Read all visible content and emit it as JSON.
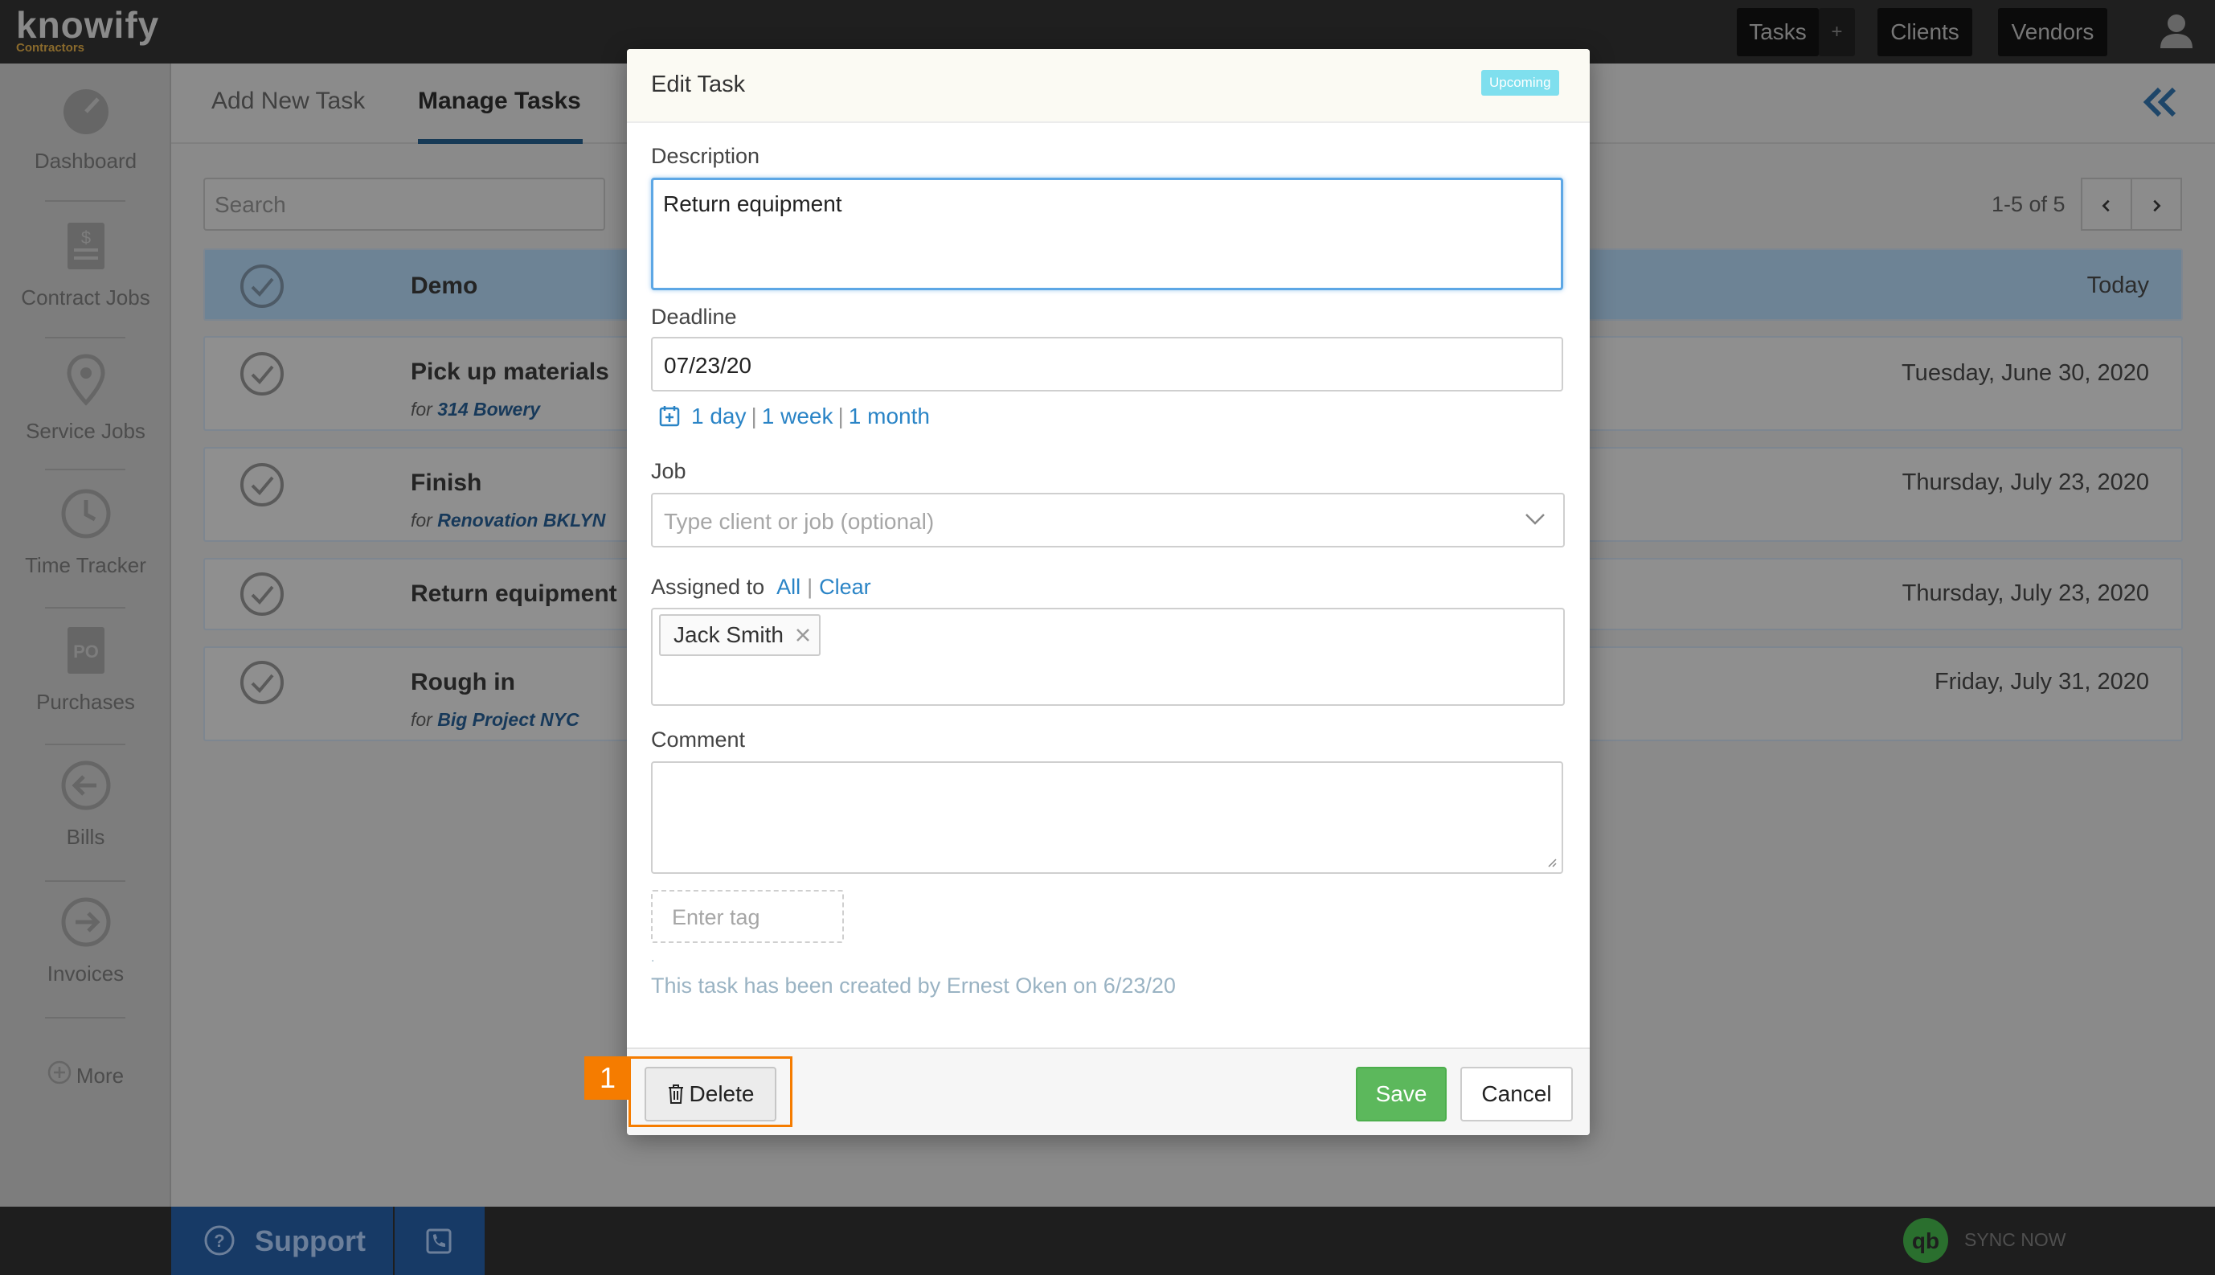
{
  "app": {
    "logo_text": "knowify",
    "logo_sub": "Contractors"
  },
  "topnav": {
    "tasks": "Tasks",
    "plus": "+",
    "clients": "Clients",
    "vendors": "Vendors"
  },
  "sidebar": {
    "items": [
      {
        "label": "Dashboard",
        "icon": "dashboard-gauge-icon"
      },
      {
        "label": "Contract Jobs",
        "icon": "contract-document-icon"
      },
      {
        "label": "Service Jobs",
        "icon": "map-pin-icon"
      },
      {
        "label": "Time Tracker",
        "icon": "clock-icon"
      },
      {
        "label": "Purchases",
        "icon": "purchase-order-icon"
      },
      {
        "label": "Bills",
        "icon": "arrow-left-circle-icon"
      },
      {
        "label": "Invoices",
        "icon": "arrow-right-circle-icon"
      }
    ],
    "more": "More"
  },
  "tabs": {
    "add_new": "Add New Task",
    "manage": "Manage Tasks"
  },
  "list": {
    "search_placeholder": "Search",
    "pager": "1-5 of 5",
    "tasks": [
      {
        "title": "Demo",
        "for_prefix": "",
        "job": "",
        "date": "Today"
      },
      {
        "title": "Pick up materials",
        "for_prefix": "for",
        "job": "314 Bowery",
        "date": "Tuesday, June 30, 2020"
      },
      {
        "title": "Finish",
        "for_prefix": "for",
        "job": "Renovation BKLYN",
        "date": "Thursday, July 23, 2020"
      },
      {
        "title": "Return equipment",
        "for_prefix": "",
        "job": "",
        "date": "Thursday, July 23, 2020"
      },
      {
        "title": "Rough in",
        "for_prefix": "for",
        "job": "Big Project NYC",
        "date": "Friday, July 31, 2020"
      }
    ]
  },
  "modal": {
    "title": "Edit Task",
    "status_badge": "Upcoming",
    "description_label": "Description",
    "description_value": "Return equipment",
    "deadline_label": "Deadline",
    "deadline_value": "07/23/20",
    "quick": {
      "day": "1 day",
      "week": "1 week",
      "month": "1 month",
      "sep": "|"
    },
    "job_label": "Job",
    "job_placeholder": "Type client or job (optional)",
    "assigned_label": "Assigned to",
    "assigned_all": "All",
    "assigned_sep": "|",
    "assigned_clear": "Clear",
    "assignee": "Jack Smith",
    "comment_label": "Comment",
    "comment_value": "",
    "tag_placeholder": "Enter tag",
    "dot": ".",
    "created_note": "This task has been created by Ernest Oken on 6/23/20",
    "delete_label": "Delete",
    "save_label": "Save",
    "cancel_label": "Cancel"
  },
  "annotation": {
    "marker": "1",
    "color": "#f57c00"
  },
  "footer": {
    "support": "Support",
    "sync": "SYNC NOW"
  },
  "colors": {
    "accent_blue": "#2a84c6",
    "save_green": "#5cb85c",
    "badge_cyan": "#7fdfee"
  }
}
